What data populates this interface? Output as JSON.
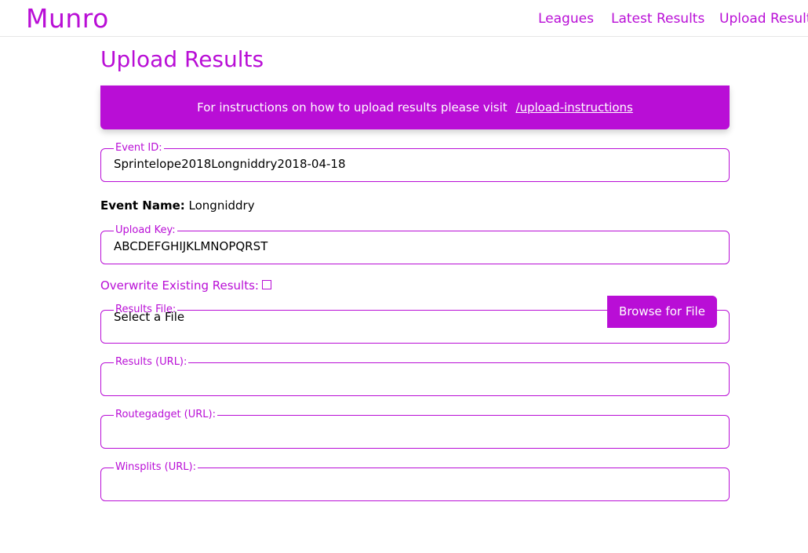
{
  "nav": {
    "brand": "Munro",
    "links": [
      "Leagues",
      "Latest Results",
      "Upload Results"
    ]
  },
  "page": {
    "title": "Upload Results"
  },
  "banner": {
    "text": "For instructions on how to upload results please visit",
    "link": "/upload-instructions"
  },
  "form": {
    "event_id": {
      "label": "Event ID:",
      "value": "Sprintelope2018Longniddry2018-04-18"
    },
    "event_name": {
      "label": "Event Name:",
      "value": "Longniddry"
    },
    "upload_key": {
      "label": "Upload Key:",
      "value": "ABCDEFGHIJKLMNOPQRST"
    },
    "overwrite": {
      "label": "Overwrite Existing Results:",
      "checked": false
    },
    "results_file": {
      "label": "Results File:",
      "value": "Select a File",
      "button": "Browse for File"
    },
    "results_url": {
      "label": "Results (URL):",
      "value": ""
    },
    "routegadget_url": {
      "label": "Routegadget (URL):",
      "value": ""
    },
    "winsplits_url": {
      "label": "Winsplits (URL):",
      "value": ""
    }
  },
  "colors": {
    "accent": "#b90ed6",
    "banner_text": "#ffffff"
  }
}
